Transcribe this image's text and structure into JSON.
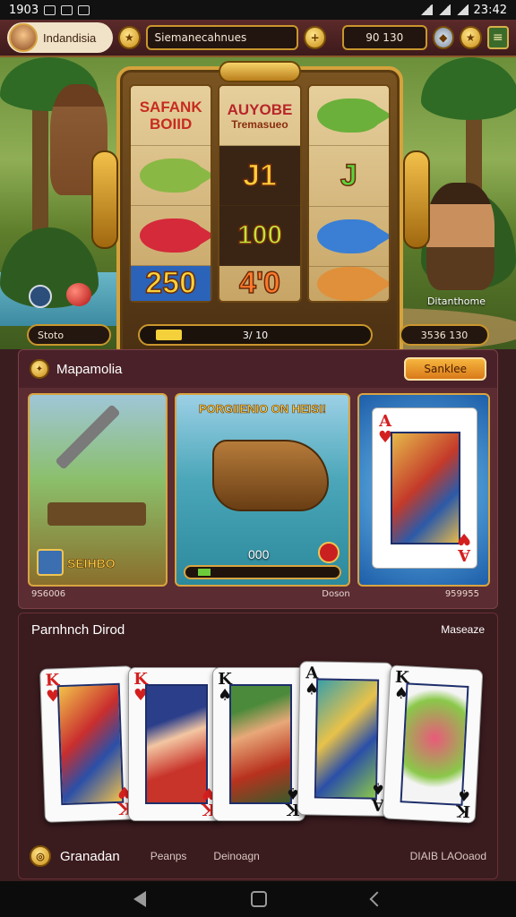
{
  "status_bar": {
    "time": "1903",
    "right_time": "23:42"
  },
  "top_hud": {
    "player_name": "Indandisia",
    "balance_label": "Siemanecahnues",
    "coins": "90 130"
  },
  "slot": {
    "reels": [
      [
        {
          "type": "text",
          "title": "SAFANK",
          "sub": "BOIID"
        },
        {
          "type": "fish",
          "color": "#8ab844"
        },
        {
          "type": "fish",
          "color": "#d42a3a"
        },
        {
          "type": "num",
          "value": "250",
          "style": "blue"
        }
      ],
      [
        {
          "type": "text",
          "title": "AUYOBE",
          "sub": "Tremasueo"
        },
        {
          "type": "num",
          "value": "J1",
          "style": "gold"
        },
        {
          "type": "num",
          "value": "100",
          "style": "dark"
        },
        {
          "type": "num",
          "value": "4'0",
          "style": "gold"
        }
      ],
      [
        {
          "type": "fish",
          "color": "#6bb03a"
        },
        {
          "type": "num",
          "value": "J",
          "style": "green"
        },
        {
          "type": "fish",
          "color": "#3a7fd4"
        },
        {
          "type": "fish",
          "color": "#e0903a"
        }
      ]
    ],
    "bet_left": "Stoto",
    "progress_label": "3/ 10",
    "progress_fill": 0.12,
    "bet_right": "3536 130",
    "character_label": "Ditanthome"
  },
  "section1": {
    "title": "Mapamolia",
    "button": "Sanklee",
    "card1_label": "SEIHBO",
    "card2_title": "PORGIIENIO ON HEISI!",
    "card2_count": "000",
    "card2_progress": 0.08,
    "footer_left": "9S6006",
    "footer_mid": "Doson",
    "footer_right": "959955"
  },
  "section2": {
    "title": "Parnhnch Dirod",
    "right_label": "Maseaze",
    "cards": [
      {
        "rank": "K",
        "suit": "♥",
        "suit_color": "#d41f1f",
        "art": "linear-gradient(135deg,#f2c24a,#c92e2e 40%,#2b4fa8 65%,#f2c24a)"
      },
      {
        "rank": "K",
        "suit": "♥",
        "suit_color": "#d41f1f",
        "art": "linear-gradient(160deg,#2a3e8a 30%,#f3c6a2 45%,#c8332a 70%)"
      },
      {
        "rank": "K",
        "suit": "♠",
        "suit_color": "#111111",
        "art": "linear-gradient(160deg,#4a8a3a 20%,#e8a878 40%,#b8321e 70%,#3a5a2a)"
      },
      {
        "rank": "A",
        "suit": "♠",
        "suit_color": "#111111",
        "art": "linear-gradient(135deg,#3aa0a8,#e8c24a 40%,#2b4fa8 65%,#8ac84a)"
      },
      {
        "rank": "K",
        "suit": "♠",
        "suit_color": "#111111",
        "art": "radial-gradient(circle at 50% 45%,#e95a7a,#8ac84a 55%,#f4f4f4 70%)"
      }
    ],
    "footer_title": "Granadan",
    "tab1": "Peanps",
    "tab2": "Deinoagn",
    "footer_right": "DIAIB LAOoaod"
  }
}
